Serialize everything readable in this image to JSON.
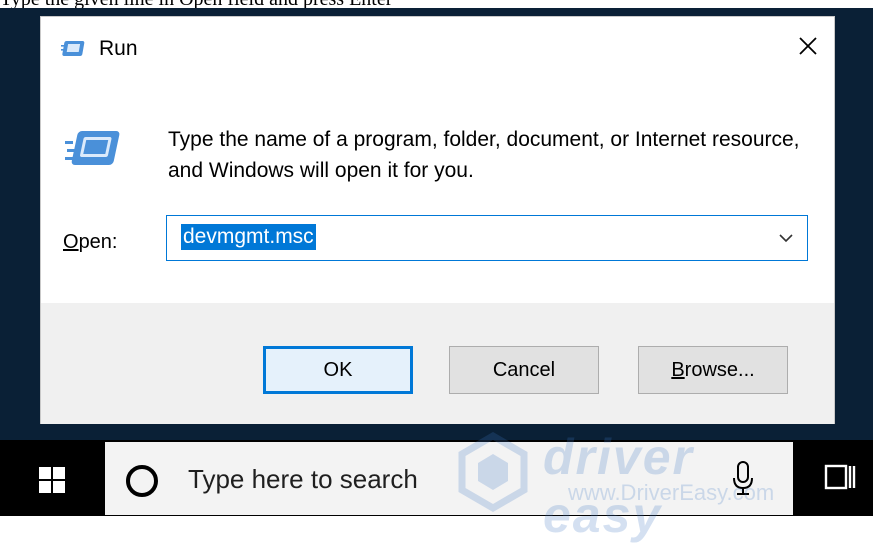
{
  "caption": "Type the given line in Open field and press Enter",
  "dialog": {
    "title": "Run",
    "description": "Type the name of a program, folder, document, or Internet resource, and Windows will open it for you.",
    "open_label_accel": "O",
    "open_label_rest": "pen:",
    "open_value": "devmgmt.msc",
    "buttons": {
      "ok": "OK",
      "cancel": "Cancel",
      "browse_accel": "B",
      "browse_rest": "rowse..."
    }
  },
  "taskbar": {
    "search_placeholder": "Type here to search"
  },
  "watermark": {
    "brand": "driver easy",
    "url": "www.DriverEasy.com"
  },
  "icons": {
    "title": "run-icon",
    "close": "close-icon",
    "big": "run-large-icon",
    "dropdown": "chevron-down-icon",
    "start": "windows-logo-icon",
    "search": "cortana-circle-icon",
    "mic": "microphone-icon",
    "taskview": "task-view-icon"
  },
  "colors": {
    "accent": "#0078d7",
    "desktop": "#0a2036",
    "taskbar": "#000000",
    "footer": "#f0f0f0"
  }
}
